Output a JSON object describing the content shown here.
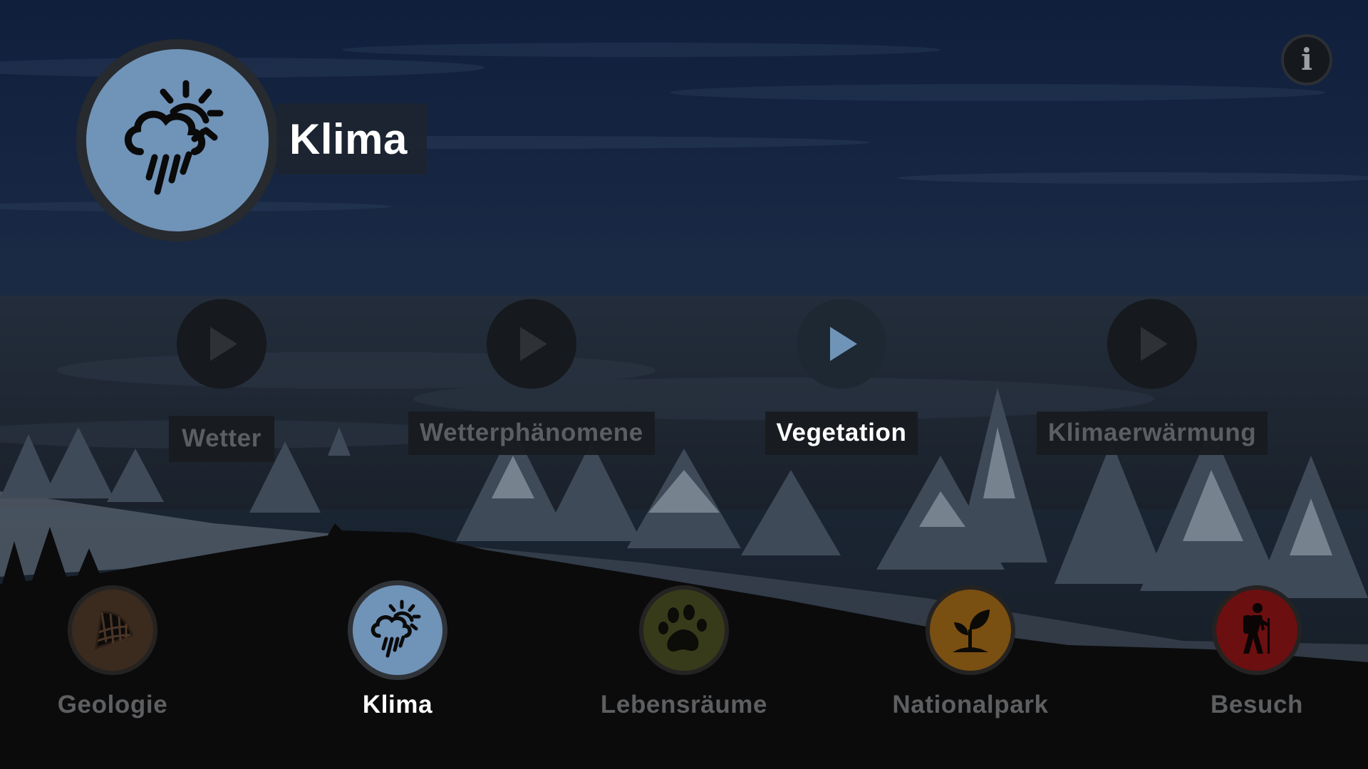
{
  "header": {
    "icon": "cloud-rain-sun-icon",
    "title": "Klima"
  },
  "info_button": {
    "icon": "info-icon",
    "glyph": "i"
  },
  "chapters": [
    {
      "label": "Wetter",
      "icon": "play-icon",
      "active": false
    },
    {
      "label": "Wetterphänomene",
      "icon": "play-icon",
      "active": false
    },
    {
      "label": "Vegetation",
      "icon": "play-icon",
      "active": true
    },
    {
      "label": "Klimaerwärmung",
      "icon": "play-icon",
      "active": false
    }
  ],
  "nav": [
    {
      "label": "Geologie",
      "icon": "rock-layers-icon",
      "color": "#3b2a1e",
      "active": false
    },
    {
      "label": "Klima",
      "icon": "cloud-rain-sun-icon",
      "color": "#7093b8",
      "active": true
    },
    {
      "label": "Lebensräume",
      "icon": "paw-icon",
      "color": "#383b1a",
      "active": false
    },
    {
      "label": "Nationalpark",
      "icon": "sprout-icon",
      "color": "#7a4f12",
      "active": false
    },
    {
      "label": "Besuch",
      "icon": "hiker-icon",
      "color": "#6b0f10",
      "active": false
    }
  ],
  "colors": {
    "accent": "#7093b8",
    "sky_top": "#0f1f3c",
    "sky_bottom": "#1c2838",
    "ground": "#0b0b0c"
  }
}
